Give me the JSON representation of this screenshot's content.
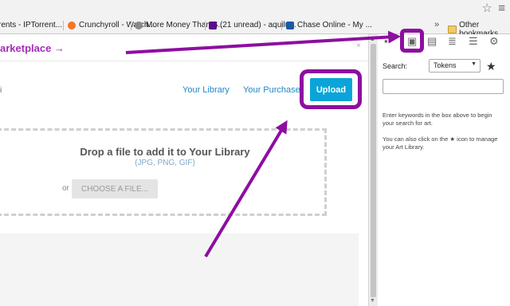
{
  "bookmarks": [
    {
      "label": "rents - IPTorrent...",
      "icon": "none"
    },
    {
      "label": "Crunchyroll - Watch...",
      "icon": "crunchyroll-icon",
      "color": "#f47521"
    },
    {
      "label": "More Money Than S...",
      "icon": "speech-bubble-icon",
      "color": "#888888"
    },
    {
      "label": "(21 unread) - aquilu...",
      "icon": "mail-icon",
      "color": "#5b0b8c"
    },
    {
      "label": "Chase Online - My ...",
      "icon": "chase-icon",
      "color": "#1a5aa6"
    }
  ],
  "bookmarks_more": "»",
  "other_bookmarks": "Other bookmarks",
  "left": {
    "marketplace_link": "arketplace →",
    "close": "×",
    "stray": "i",
    "your_library": "Your Library",
    "your_purchases": "Your Purchase",
    "upload_button": "Upload",
    "drop_title": "Drop a file to add it to Your Library",
    "drop_types": "(JPG, PNG, GIF)",
    "or_label": "or",
    "choose_file": "CHOOSE A FILE..."
  },
  "right": {
    "search_label": "Search:",
    "search_type": "Tokens",
    "search_value": "",
    "star": "★",
    "help_line1": "Enter keywords in the box above to begin your search for art.",
    "help_line2": "You can also click on the ★ icon to manage your Art Library.",
    "toolbar_icons": [
      "chat-icon",
      "art-library-icon",
      "journal-icon",
      "playlist-icon",
      "list-icon",
      "gear-icon"
    ]
  },
  "colors": {
    "accent": "#0aa4d9",
    "highlight": "#8d0ea0",
    "link": "#1e88c7",
    "marketplace": "#a52bb8"
  }
}
